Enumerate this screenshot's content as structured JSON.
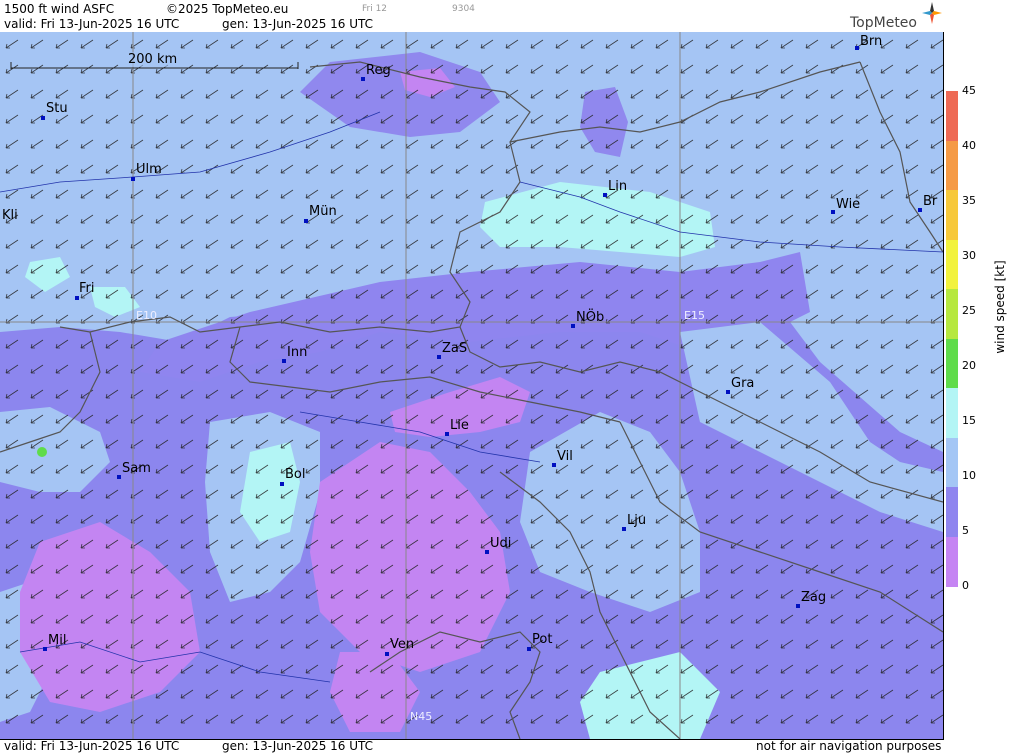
{
  "header": {
    "product": "1500 ft wind ASFC",
    "copyright": "©2025 TopMeteo.eu",
    "day_label": "Fri 12",
    "code": "9304",
    "valid": "valid:  Fri  13-Jun-2025  16 UTC",
    "gen": "gen: 13-Jun-2025  16 UTC",
    "brand": "TopMeteo"
  },
  "map": {
    "scale_label": "200 km",
    "grid_labels": {
      "e10": "E10",
      "e15": "E15",
      "n45": "N45"
    },
    "cities": [
      {
        "code": "Brn"
      },
      {
        "code": "Reg"
      },
      {
        "code": "Stu"
      },
      {
        "code": "Ulm"
      },
      {
        "code": "Lin"
      },
      {
        "code": "Wie"
      },
      {
        "code": "Br"
      },
      {
        "code": "Kli"
      },
      {
        "code": "Mün"
      },
      {
        "code": "Fri"
      },
      {
        "code": "NÖb"
      },
      {
        "code": "Inn"
      },
      {
        "code": "ZaS"
      },
      {
        "code": "Gra"
      },
      {
        "code": "Lie"
      },
      {
        "code": "Vil"
      },
      {
        "code": "Sam"
      },
      {
        "code": "Bol"
      },
      {
        "code": "Lju"
      },
      {
        "code": "Udi"
      },
      {
        "code": "Zag"
      },
      {
        "code": "Mil"
      },
      {
        "code": "Ven"
      },
      {
        "code": "Pot"
      }
    ]
  },
  "legend": {
    "title": "wind  speed  [kt]",
    "ticks": [
      "45",
      "40",
      "35",
      "30",
      "25",
      "20",
      "15",
      "10",
      "5",
      "0"
    ],
    "colors": [
      "#ee6a55",
      "#f59a45",
      "#f7c83a",
      "#f2f23d",
      "#b6e83f",
      "#5fdc4a",
      "#b3f5f5",
      "#a4c6f5",
      "#8f85ef",
      "#c584f3"
    ]
  },
  "footer": {
    "valid": "valid:  Fri  13-Jun-2025  16 UTC",
    "gen": "gen: 13-Jun-2025  16 UTC",
    "disclaimer": "not for air navigation purposes"
  }
}
